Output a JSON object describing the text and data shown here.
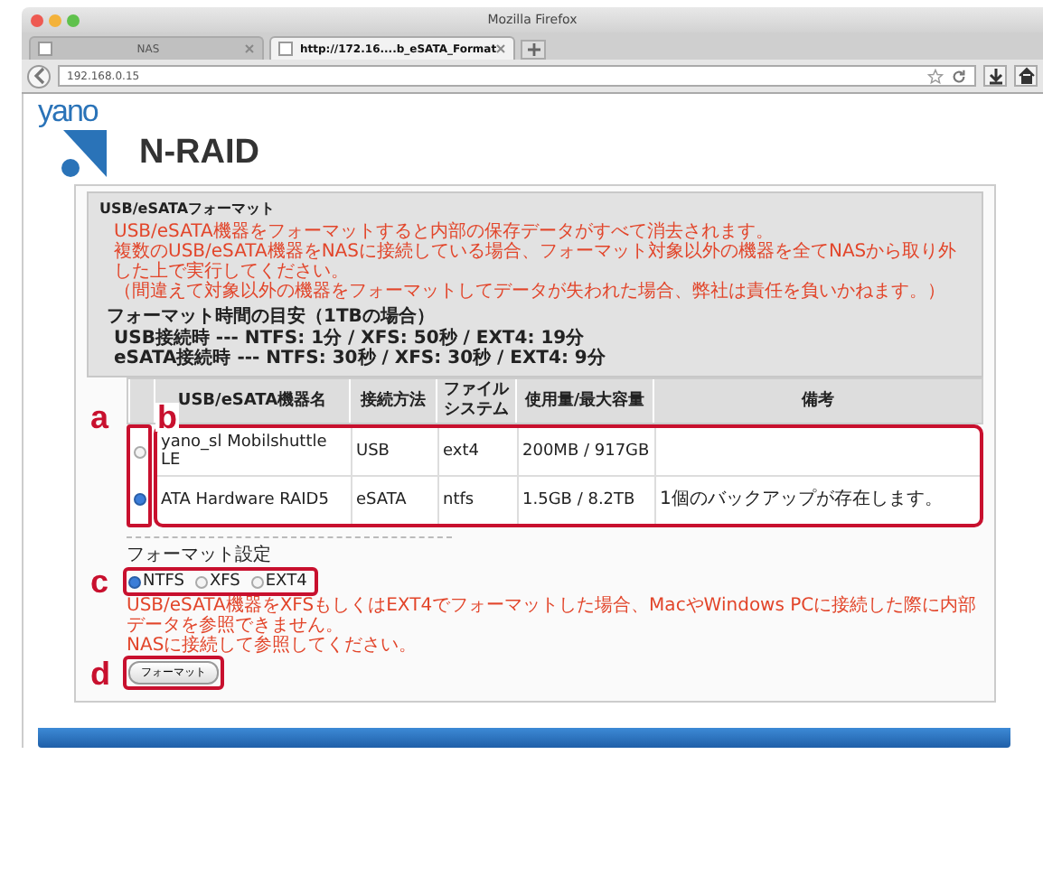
{
  "window": {
    "title": "Mozilla Firefox"
  },
  "tabs": [
    {
      "label": "NAS",
      "selected": false
    },
    {
      "label": "http://172.16....b_eSATA_Format",
      "selected": true
    }
  ],
  "address_bar": {
    "url": "192.168.0.15"
  },
  "logo": {
    "brand": "yano",
    "product": "N-RAID"
  },
  "section": {
    "title": "USB/eSATAフォーマット",
    "warnings": [
      "USB/eSATA機器をフォーマットすると内部の保存データがすべて消去されます。",
      "複数のUSB/eSATA機器をNASに接続している場合、フォーマット対象以外の機器を全てNASから取り外した上で実行してください。",
      "（間違えて対象以外の機器をフォーマットしてデータが失われた場合、弊社は責任を負いかねます。）"
    ],
    "time_title": "フォーマット時間の目安（1TBの場合）",
    "time_lines": [
      "USB接続時 --- NTFS: 1分 / XFS: 50秒 / EXT4: 19分",
      "eSATA接続時 --- NTFS: 30秒 / XFS: 30秒 / EXT4: 9分"
    ]
  },
  "table": {
    "columns": [
      "USB/eSATA機器名",
      "接続方法",
      "ファイルシステム",
      "使用量/最大容量",
      "備考"
    ],
    "rows": [
      {
        "selected": false,
        "cells": [
          "yano_sl Mobilshuttle LE",
          "USB",
          "ext4",
          "200MB / 917GB",
          ""
        ]
      },
      {
        "selected": true,
        "cells": [
          "ATA Hardware RAID5",
          "eSATA",
          "ntfs",
          "1.5GB / 8.2TB",
          "1個のバックアップが存在します。"
        ]
      }
    ]
  },
  "format_settings": {
    "title": "フォーマット設定",
    "options": [
      {
        "label": "NTFS",
        "selected": true
      },
      {
        "label": "XFS",
        "selected": false
      },
      {
        "label": "EXT4",
        "selected": false
      }
    ],
    "notes": [
      "USB/eSATA機器をXFSもしくはEXT4でフォーマットした場合、MacやWindows PCに接続した際に内部データを参照できません。",
      "NASに接続して参照してください。"
    ],
    "button": "フォーマット"
  },
  "annotations": [
    {
      "label": "a"
    },
    {
      "label": "b"
    },
    {
      "label": "c"
    },
    {
      "label": "d"
    }
  ]
}
